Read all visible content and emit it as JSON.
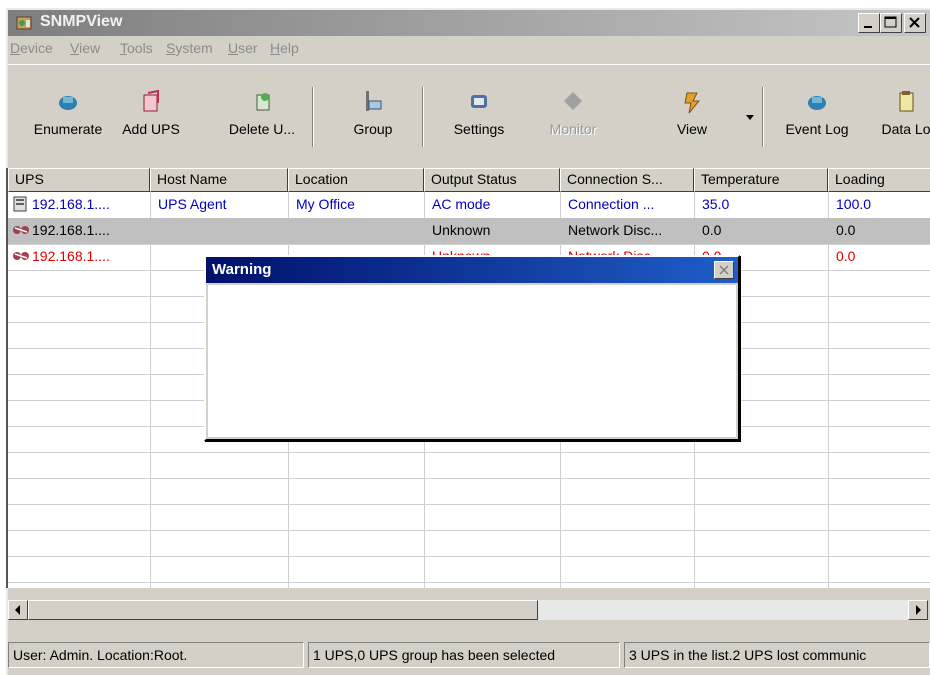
{
  "window": {
    "title": "SNMPView"
  },
  "menu": [
    "Device",
    "View",
    "Tools",
    "System",
    "User",
    "Help"
  ],
  "toolbar": [
    {
      "label": "Enumerate",
      "icon": "enumerate-icon",
      "disabled": false
    },
    {
      "label": "Add UPS",
      "icon": "add-ups-icon",
      "disabled": false
    },
    {
      "label": "Delete U...",
      "icon": "delete-ups-icon",
      "disabled": false
    },
    {
      "label": "Group",
      "icon": "group-icon",
      "disabled": false
    },
    {
      "label": "Settings",
      "icon": "settings-icon",
      "disabled": false
    },
    {
      "label": "Monitor",
      "icon": "monitor-icon",
      "disabled": true
    },
    {
      "label": "View",
      "icon": "view-icon",
      "disabled": false
    },
    {
      "label": "Event Log",
      "icon": "event-log-icon",
      "disabled": false
    },
    {
      "label": "Data Lo",
      "icon": "data-log-icon",
      "disabled": false
    }
  ],
  "columns": [
    "UPS",
    "Host Name",
    "Location",
    "Output Status",
    "Connection S...",
    "Temperature",
    "Loading"
  ],
  "rows": [
    {
      "cells": [
        "192.168.1....",
        "UPS Agent",
        "My Office",
        "AC mode",
        "Connection ...",
        "35.0",
        "100.0"
      ],
      "color": "#0000c0",
      "icon": "ups-connected-icon"
    },
    {
      "cells": [
        "192.168.1....",
        "",
        "",
        "Unknown",
        "Network Disc...",
        "0.0",
        "0.0"
      ],
      "color": "#000000",
      "icon": "ups-disconnected-icon"
    },
    {
      "cells": [
        "192.168.1....",
        "",
        "",
        "Unknown",
        "Network Disc...",
        "0.0",
        "0.0"
      ],
      "color": "#e00000",
      "icon": "ups-disconnected-icon"
    }
  ],
  "dialog": {
    "title": "Warning"
  },
  "status": {
    "user": "User: Admin.  Location:Root.",
    "selection": "1 UPS,0 UPS group has been selected",
    "list": "3 UPS in the list.2 UPS  lost communic"
  },
  "colors": {
    "title_active": "#00106b",
    "selected_row": "#c0c0c0",
    "link_blue": "#0000c0",
    "error_red": "#e00000"
  }
}
